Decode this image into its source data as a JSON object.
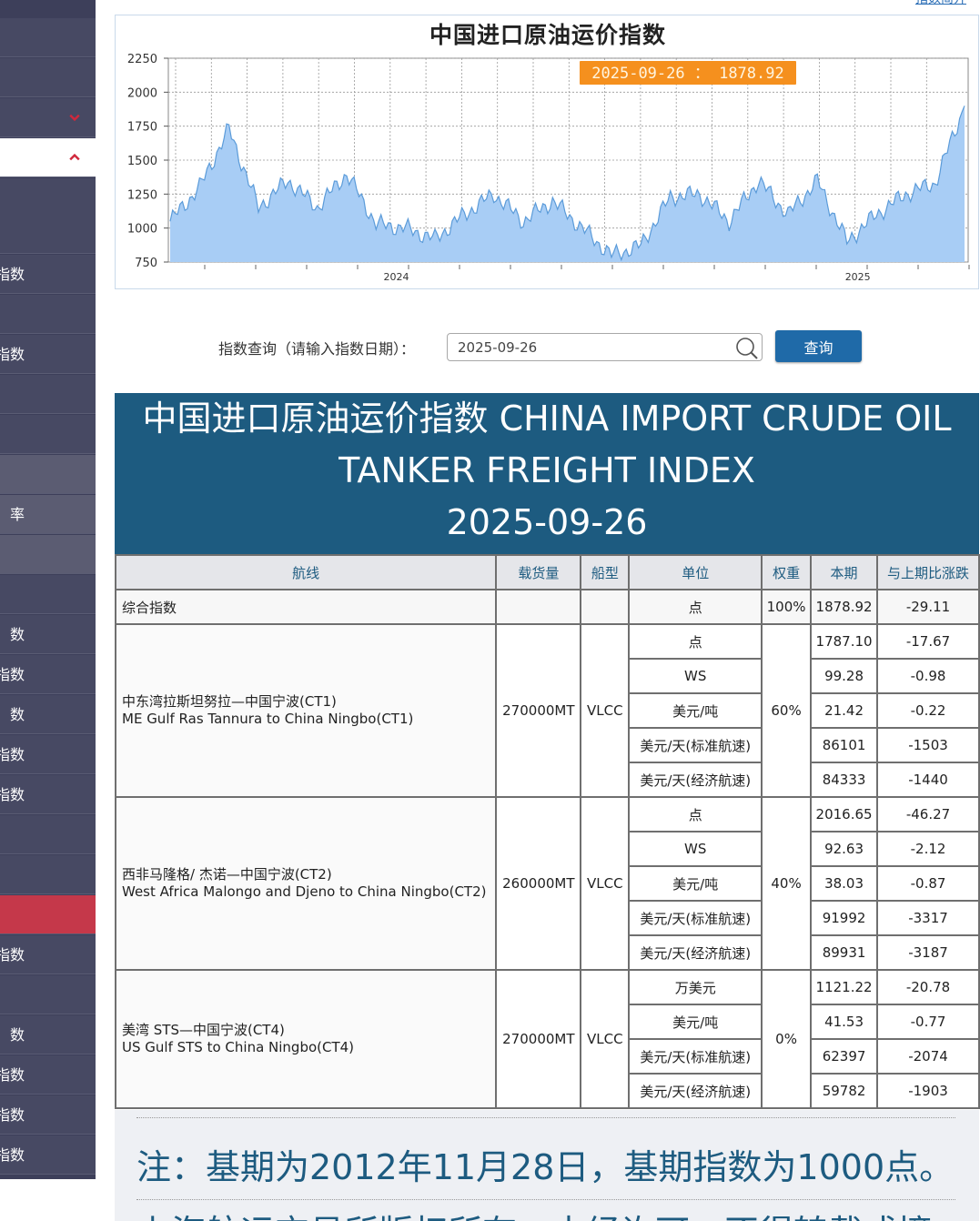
{
  "top_link": "指数简介",
  "sidebar": {
    "items": [
      {
        "label": ""
      },
      {
        "label": ""
      },
      {
        "label": ""
      },
      {
        "label": ""
      },
      {
        "label": ""
      },
      {
        "label": ""
      },
      {
        "label": "指数"
      },
      {
        "label": ""
      },
      {
        "label": "价指数"
      },
      {
        "label": ""
      },
      {
        "label": ""
      },
      {
        "label": ""
      },
      {
        "label": "率"
      },
      {
        "label": ""
      },
      {
        "label": ""
      },
      {
        "label": "数"
      },
      {
        "label": "价指数"
      },
      {
        "label": "数"
      },
      {
        "label": "指数"
      },
      {
        "label": "指数"
      },
      {
        "label": ""
      },
      {
        "label": ""
      },
      {
        "label": ""
      },
      {
        "label": "运指数"
      },
      {
        "label": ""
      },
      {
        "label": "数"
      },
      {
        "label": "运量指数"
      },
      {
        "label": "指数"
      },
      {
        "label": "洲指数"
      }
    ]
  },
  "chart": {
    "title": "中国进口原油运价指数",
    "tooltip": "2025-09-26 ： 1878.92",
    "colors": {
      "fill": "#a8cdf5",
      "line": "#5b9bd9",
      "tooltip_bg": "#f5901e"
    }
  },
  "chart_data": {
    "type": "area",
    "title": "中国进口原油运价指数",
    "xlabel": "",
    "ylabel": "",
    "ylim": [
      750,
      2250
    ],
    "yticks": [
      750,
      1000,
      1250,
      1500,
      1750,
      2000,
      2250
    ],
    "xtick_labels": [
      "2024",
      "2025"
    ],
    "grid": true,
    "series": [
      {
        "x": [
          "2023-06",
          "2023-07",
          "2023-08",
          "2023-09",
          "2023-10",
          "2023-11",
          "2023-12",
          "2024-01",
          "2024-02",
          "2024-03",
          "2024-04",
          "2024-05",
          "2024-06",
          "2024-07",
          "2024-08",
          "2024-09",
          "2024-10",
          "2024-11",
          "2024-12",
          "2025-01",
          "2025-02",
          "2025-03",
          "2025-04",
          "2025-05",
          "2025-06",
          "2025-07",
          "2025-08",
          "2025-09"
        ],
        "values": [
          1050,
          1300,
          1730,
          1150,
          1350,
          1150,
          1400,
          1030,
          1000,
          920,
          1100,
          1250,
          1050,
          1200,
          1000,
          800,
          870,
          1230,
          1250,
          1050,
          1350,
          1100,
          1350,
          900,
          1100,
          1250,
          1330,
          1900
        ]
      }
    ]
  },
  "query": {
    "label": "指数查询（请输入指数日期）：",
    "input_value": "2025-09-26",
    "button_label": "查询"
  },
  "index_header": {
    "line1": "中国进口原油运价指数 CHINA IMPORT CRUDE OIL",
    "line2": "TANKER FREIGHT INDEX",
    "line3": "2025-09-26"
  },
  "table": {
    "headers": [
      "航线",
      "载货量",
      "船型",
      "单位",
      "权重",
      "本期",
      "与上期比涨跌"
    ],
    "composite": {
      "route": "综合指数",
      "unit": "点",
      "weight": "100%",
      "current": "1878.92",
      "change": "-29.11"
    },
    "groups": [
      {
        "route_cn": "中东湾拉斯坦努拉—中国宁波(CT1)",
        "route_en": "ME Gulf Ras Tannura to China Ningbo(CT1)",
        "load": "270000MT",
        "ship": "VLCC",
        "weight": "60%",
        "rows": [
          {
            "unit": "点",
            "current": "1787.10",
            "change": "-17.67"
          },
          {
            "unit": "WS",
            "current": "99.28",
            "change": "-0.98"
          },
          {
            "unit": "美元/吨",
            "current": "21.42",
            "change": "-0.22"
          },
          {
            "unit": "美元/天(标准航速)",
            "current": "86101",
            "change": "-1503"
          },
          {
            "unit": "美元/天(经济航速)",
            "current": "84333",
            "change": "-1440"
          }
        ]
      },
      {
        "route_cn": "西非马隆格/ 杰诺—中国宁波(CT2)",
        "route_en": "West Africa Malongo and Djeno to China Ningbo(CT2)",
        "load": "260000MT",
        "ship": "VLCC",
        "weight": "40%",
        "rows": [
          {
            "unit": "点",
            "current": "2016.65",
            "change": "-46.27"
          },
          {
            "unit": "WS",
            "current": "92.63",
            "change": "-2.12"
          },
          {
            "unit": "美元/吨",
            "current": "38.03",
            "change": "-0.87"
          },
          {
            "unit": "美元/天(标准航速)",
            "current": "91992",
            "change": "-3317"
          },
          {
            "unit": "美元/天(经济航速)",
            "current": "89931",
            "change": "-3187"
          }
        ]
      },
      {
        "route_cn": "美湾 STS—中国宁波(CT4)",
        "route_en": "US Gulf STS to China Ningbo(CT4)",
        "load": "270000MT",
        "ship": "VLCC",
        "weight": "0%",
        "rows": [
          {
            "unit": "万美元",
            "current": "1121.22",
            "change": "-20.78"
          },
          {
            "unit": "美元/吨",
            "current": "41.53",
            "change": "-0.77"
          },
          {
            "unit": "美元/天(标准航速)",
            "current": "62397",
            "change": "-2074"
          },
          {
            "unit": "美元/天(经济航速)",
            "current": "59782",
            "change": "-1903"
          }
        ]
      }
    ]
  },
  "note": {
    "text": "注：基期为2012年11月28日，基期指数为1000点。",
    "text2": "上海航运交易所版权所有，未经许可，不得转载或摘"
  }
}
